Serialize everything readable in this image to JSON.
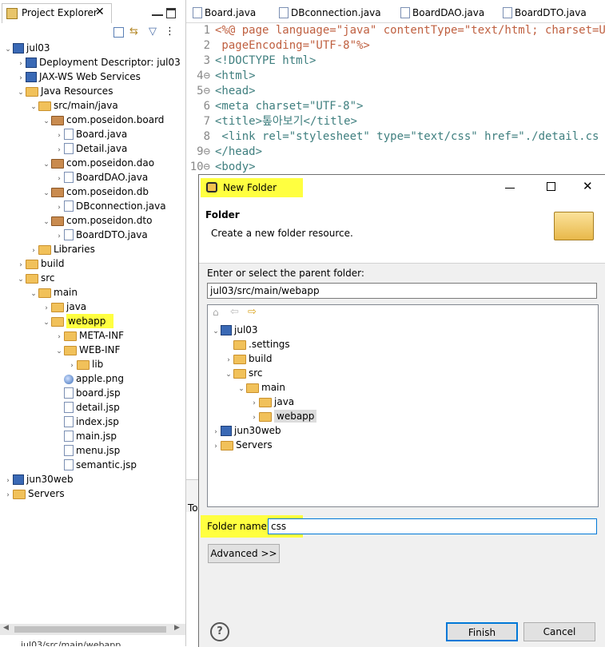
{
  "project_explorer": {
    "tab_label": "Project Explorer",
    "tree": [
      {
        "label": "jul03",
        "depth": 0,
        "toggle": "open",
        "icon": "project"
      },
      {
        "label": "Deployment Descriptor: jul03",
        "depth": 1,
        "toggle": "closed",
        "icon": "descriptor"
      },
      {
        "label": "JAX-WS Web Services",
        "depth": 1,
        "toggle": "closed",
        "icon": "webservices"
      },
      {
        "label": "Java Resources",
        "depth": 1,
        "toggle": "open",
        "icon": "javares"
      },
      {
        "label": "src/main/java",
        "depth": 2,
        "toggle": "open",
        "icon": "srcfolder"
      },
      {
        "label": "com.poseidon.board",
        "depth": 3,
        "toggle": "open",
        "icon": "package"
      },
      {
        "label": "Board.java",
        "depth": 4,
        "toggle": "closed",
        "icon": "java"
      },
      {
        "label": "Detail.java",
        "depth": 4,
        "toggle": "closed",
        "icon": "java"
      },
      {
        "label": "com.poseidon.dao",
        "depth": 3,
        "toggle": "open",
        "icon": "package"
      },
      {
        "label": "BoardDAO.java",
        "depth": 4,
        "toggle": "closed",
        "icon": "java"
      },
      {
        "label": "com.poseidon.db",
        "depth": 3,
        "toggle": "open",
        "icon": "package"
      },
      {
        "label": "DBconnection.java",
        "depth": 4,
        "toggle": "closed",
        "icon": "java"
      },
      {
        "label": "com.poseidon.dto",
        "depth": 3,
        "toggle": "open",
        "icon": "package"
      },
      {
        "label": "BoardDTO.java",
        "depth": 4,
        "toggle": "closed",
        "icon": "java"
      },
      {
        "label": "Libraries",
        "depth": 2,
        "toggle": "closed",
        "icon": "library"
      },
      {
        "label": "build",
        "depth": 1,
        "toggle": "closed",
        "icon": "folder"
      },
      {
        "label": "src",
        "depth": 1,
        "toggle": "open",
        "icon": "folder"
      },
      {
        "label": "main",
        "depth": 2,
        "toggle": "open",
        "icon": "folder"
      },
      {
        "label": "java",
        "depth": 3,
        "toggle": "closed",
        "icon": "folder"
      },
      {
        "label": "webapp",
        "depth": 3,
        "toggle": "open",
        "icon": "folder",
        "highlight": true
      },
      {
        "label": "META-INF",
        "depth": 4,
        "toggle": "closed",
        "icon": "folder"
      },
      {
        "label": "WEB-INF",
        "depth": 4,
        "toggle": "open",
        "icon": "folder"
      },
      {
        "label": "lib",
        "depth": 5,
        "toggle": "closed",
        "icon": "folder"
      },
      {
        "label": "apple.png",
        "depth": 4,
        "toggle": "none",
        "icon": "image"
      },
      {
        "label": "board.jsp",
        "depth": 4,
        "toggle": "none",
        "icon": "jsp"
      },
      {
        "label": "detail.jsp",
        "depth": 4,
        "toggle": "none",
        "icon": "jsp"
      },
      {
        "label": "index.jsp",
        "depth": 4,
        "toggle": "none",
        "icon": "jsp"
      },
      {
        "label": "main.jsp",
        "depth": 4,
        "toggle": "none",
        "icon": "jsp"
      },
      {
        "label": "menu.jsp",
        "depth": 4,
        "toggle": "none",
        "icon": "jsp"
      },
      {
        "label": "semantic.jsp",
        "depth": 4,
        "toggle": "none",
        "icon": "jsp"
      },
      {
        "label": "jun30web",
        "depth": 0,
        "toggle": "closed",
        "icon": "project"
      },
      {
        "label": "Servers",
        "depth": 0,
        "toggle": "closed",
        "icon": "folder"
      }
    ],
    "status_path": "jul03/src/main/webapp"
  },
  "editor": {
    "tabs": [
      "Board.java",
      "DBconnection.java",
      "BoardDAO.java",
      "BoardDTO.java"
    ],
    "lines": [
      {
        "n": "1",
        "text": "<%@ page language=\"java\" contentType=\"text/html; charset=UTF"
      },
      {
        "n": "2",
        "text": "    pageEncoding=\"UTF-8\"%>"
      },
      {
        "n": "3",
        "text": "<!DOCTYPE html>"
      },
      {
        "n": "4⊖",
        "text": "<html>"
      },
      {
        "n": "5⊖",
        "text": "<head>"
      },
      {
        "n": "6",
        "text": "<meta charset=\"UTF-8\">"
      },
      {
        "n": "7",
        "text": "<title>톺아보기</title>"
      },
      {
        "n": "8",
        "text": "    <link rel=\"stylesheet\" type=\"text/css\" href=\"./detail.cs"
      },
      {
        "n": "9⊖",
        "text": "</head>"
      },
      {
        "n": "10⊖",
        "text": "<body>"
      }
    ],
    "bottom_stub": "To"
  },
  "dialog": {
    "title": "New Folder",
    "heading": "Folder",
    "description": "Create a new folder resource.",
    "parent_label": "Enter or select the parent folder:",
    "parent_value": "jul03/src/main/webapp",
    "tree": [
      {
        "label": "jul03",
        "depth": 0,
        "toggle": "open",
        "icon": "project"
      },
      {
        "label": ".settings",
        "depth": 1,
        "toggle": "none",
        "icon": "folder"
      },
      {
        "label": "build",
        "depth": 1,
        "toggle": "closed",
        "icon": "folder"
      },
      {
        "label": "src",
        "depth": 1,
        "toggle": "open",
        "icon": "folder"
      },
      {
        "label": "main",
        "depth": 2,
        "toggle": "open",
        "icon": "folder"
      },
      {
        "label": "java",
        "depth": 3,
        "toggle": "closed",
        "icon": "folder"
      },
      {
        "label": "webapp",
        "depth": 3,
        "toggle": "closed",
        "icon": "folder",
        "selected": true
      },
      {
        "label": "jun30web",
        "depth": 0,
        "toggle": "closed",
        "icon": "project"
      },
      {
        "label": "Servers",
        "depth": 0,
        "toggle": "closed",
        "icon": "folder"
      }
    ],
    "folder_name_label": "Folder name:",
    "folder_name_value": "css",
    "advanced_label": "Advanced >>",
    "finish_label": "Finish",
    "cancel_label": "Cancel",
    "help_glyph": "?"
  },
  "colors": {
    "highlight": "#ffff40",
    "accent": "#0078d7",
    "selection": "#cce8ff"
  }
}
